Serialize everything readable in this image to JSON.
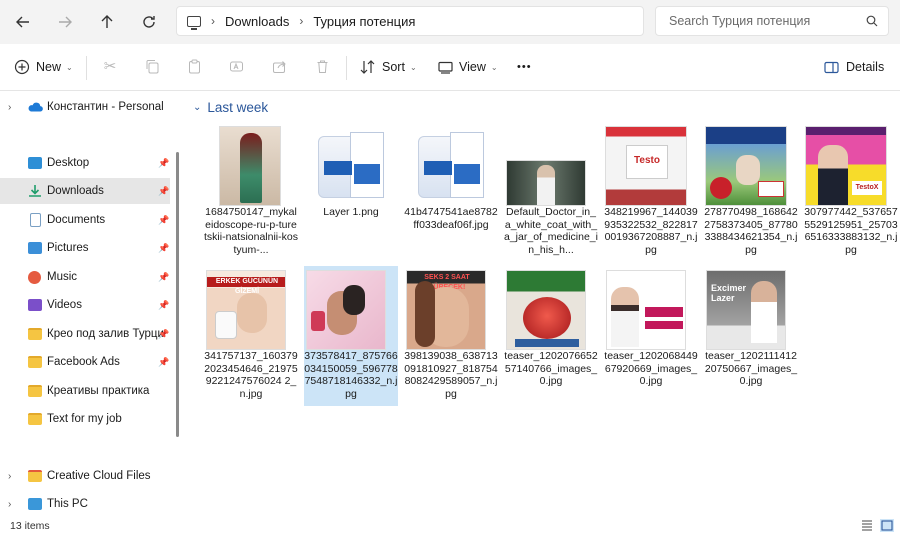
{
  "address": {
    "crumbs": [
      "Downloads",
      "Турция потенция"
    ],
    "search_placeholder": "Search Турция потенция"
  },
  "toolbar": {
    "new_label": "New",
    "sort_label": "Sort",
    "view_label": "View",
    "more_label": "•••",
    "details_label": "Details"
  },
  "sidebar": {
    "account": "Константин - Personal",
    "items": [
      {
        "label": "Desktop",
        "icon": "desktop-icon",
        "color": "#2e8fd6",
        "pinned": true
      },
      {
        "label": "Downloads",
        "icon": "download-icon",
        "color": "#1f9d6b",
        "pinned": true
      },
      {
        "label": "Documents",
        "icon": "document-icon",
        "color": "#7aa0c4",
        "pinned": true
      },
      {
        "label": "Pictures",
        "icon": "pictures-icon",
        "color": "#3b8fd8",
        "pinned": true
      },
      {
        "label": "Music",
        "icon": "music-icon",
        "color": "#e55b40",
        "pinned": true
      },
      {
        "label": "Videos",
        "icon": "videos-icon",
        "color": "#7b4fc9",
        "pinned": true
      },
      {
        "label": "Крео под залив Турци",
        "icon": "folder-icon",
        "color": "#f5c542",
        "pinned": true
      },
      {
        "label": "Facebook Ads",
        "icon": "folder-icon",
        "color": "#f5c542",
        "pinned": true
      },
      {
        "label": "Креативы практика",
        "icon": "folder-icon",
        "color": "#f5c542",
        "pinned": false
      },
      {
        "label": "Text for my job",
        "icon": "folder-icon",
        "color": "#f5c542",
        "pinned": false
      }
    ],
    "creative_cloud": "Creative Cloud Files",
    "this_pc": "This PC"
  },
  "group": {
    "label": "Last week"
  },
  "files": [
    {
      "name": "1684750147_mykaleidoscope-ru-p-turetskii-natsionalnii-kostyum-...",
      "thumb": "woman-costume"
    },
    {
      "name": "Layer 1.png",
      "thumb": "pill-box"
    },
    {
      "name": "41b4747541ae8782ff033deaf06f.jpg",
      "thumb": "pill-box"
    },
    {
      "name": "Default_Doctor_in_a_white_coat_with_a_jar_of_medicine_in_his_h...",
      "thumb": "doctor"
    },
    {
      "name": "348219967_144039935322532_8228170019367208887_n.jpg",
      "thumb": "testo-red"
    },
    {
      "name": "278770498_1686422758373405_877803388434621354_n.jpg",
      "thumb": "football"
    },
    {
      "name": "307977442_5376575529125951_257036516333883132_n.jpg",
      "thumb": "testox-pink"
    },
    {
      "name": "341757137_1603792023454646_219759221247576024 2_n.jpg",
      "thumb": "cream"
    },
    {
      "name": "373578417_875766034150059_5967787548718146332_n.jpg",
      "thumb": "couple"
    },
    {
      "name": "398139038_638713091810927_8187548082429589057_n.jpg",
      "thumb": "woman-face"
    },
    {
      "name": "teaser_120207665257140766_images_0.jpg",
      "thumb": "pomegranate"
    },
    {
      "name": "teaser_120206844967920669_images_0.jpg",
      "thumb": "doctor-woman"
    },
    {
      "name": "teaser_120211141220750667_images_0.jpg",
      "thumb": "excimer"
    }
  ],
  "status": {
    "count": "13 items"
  }
}
